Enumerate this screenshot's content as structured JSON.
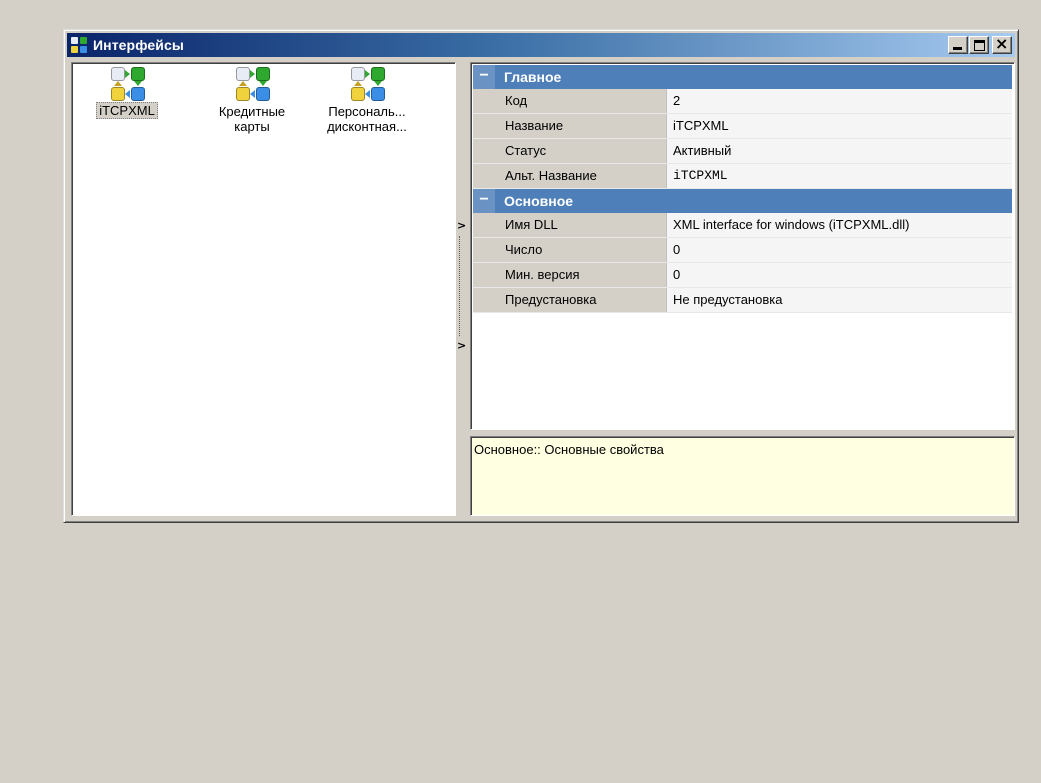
{
  "window": {
    "title": "Интерфейсы",
    "minimize_label": "_",
    "close_label": "×"
  },
  "interfaces": [
    {
      "line1": "iTCPXML",
      "line2": "",
      "selected": true
    },
    {
      "line1": "Кредитные",
      "line2": "карты",
      "selected": false
    },
    {
      "line1": "Персональ...",
      "line2": "дисконтная...",
      "selected": false
    }
  ],
  "properties": {
    "category1": {
      "toggle": "−",
      "label": "Главное",
      "rows": [
        {
          "name": "Код",
          "value": "2"
        },
        {
          "name": "Название",
          "value": "iTCPXML"
        },
        {
          "name": "Статус",
          "value": "Активный"
        },
        {
          "name": "Альт. Название",
          "value": "iTCPXML"
        }
      ]
    },
    "category2": {
      "toggle": "−",
      "label": "Основное",
      "rows": [
        {
          "name": "Имя DLL",
          "value": "XML interface for windows (iTCPXML.dll)"
        },
        {
          "name": "Число",
          "value": "0"
        },
        {
          "name": "Мин. версия",
          "value": "0"
        },
        {
          "name": "Предустановка",
          "value": "Не предустановка"
        }
      ]
    }
  },
  "splitter": {
    "arrow_top": ">",
    "arrow_bottom": ">"
  },
  "description": "Основное:: Основные свойства",
  "colors": {
    "title_gradient_start": "#0a246a",
    "title_gradient_end": "#a6caf0",
    "category_bg": "#4f7fb8",
    "description_bg": "#ffffe1",
    "icon_white": "#e8ecf4",
    "icon_green": "#2ea82e",
    "icon_yellow": "#f0d23c",
    "icon_blue": "#3a8ee6"
  }
}
